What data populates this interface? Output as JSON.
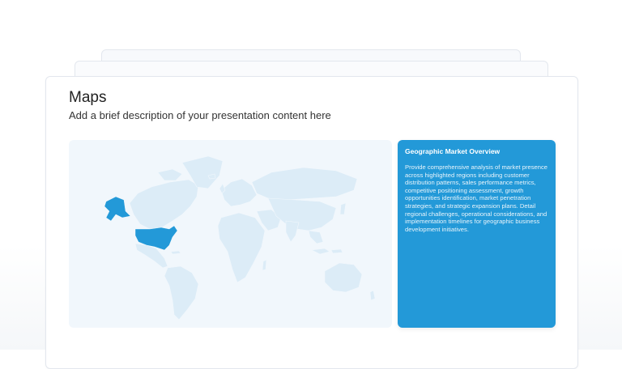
{
  "slide": {
    "title": "Maps",
    "subtitle": "Add a brief description of your presentation content here"
  },
  "map": {
    "land_color": "#dcecf7",
    "highlight_color": "#2399d8",
    "highlighted_regions": [
      "Alaska",
      "Contiguous United States"
    ]
  },
  "card": {
    "title": "Geographic Market Overview",
    "body": "Provide comprehensive analysis of market presence across highlighted regions including customer distribution patterns, sales performance metrics, competitive positioning assessment, growth opportunities identification, market penetration strategies, and strategic expansion plans. Detail regional challenges, operational considerations, and implementation timelines for geographic business development initiatives.",
    "background": "#2399d8"
  }
}
